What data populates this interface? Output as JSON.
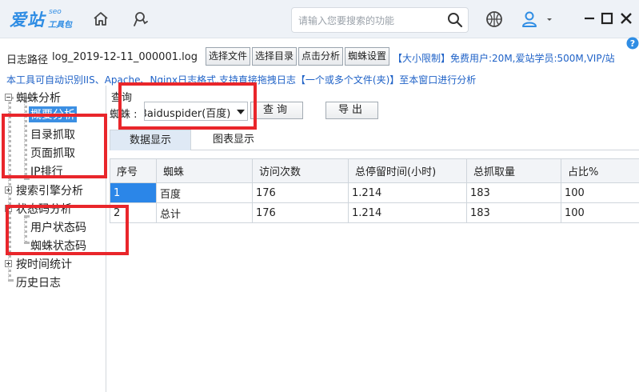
{
  "app": {
    "logo_text": "爱站",
    "logo_seo": "seo",
    "logo_sub": "工具包"
  },
  "titlebar": {
    "search_placeholder": "请输入您要搜索的功能",
    "icons": [
      "home-icon",
      "spider-tool-icon",
      "search-icon",
      "basketball-icon",
      "user-icon",
      "dropdown-icon",
      "close-icon",
      "maximize-icon",
      "minimize-icon"
    ]
  },
  "toolbar": {
    "path_label": "日志路径",
    "path_value": "log_2019-12-11_000001.log",
    "btn_select_file": "选择文件",
    "btn_select_dir": "选择目录",
    "btn_analyze": "点击分析",
    "btn_spider_settings": "蜘蛛设置",
    "size_limit_info": "【大小限制】免费用户:20M,爱站学员:500M,VIP/站",
    "tip": "本工具可自动识别IIS、Apache、Nginx日志格式,支持直接拖拽日志【一个或多个文件(夹)】至本窗口进行分析"
  },
  "sidebar": {
    "items": [
      {
        "label": "蜘蛛分析"
      },
      {
        "label": "概要分析"
      },
      {
        "label": "目录抓取"
      },
      {
        "label": "页面抓取"
      },
      {
        "label": "IP排行"
      },
      {
        "label": "搜索引擎分析"
      },
      {
        "label": "状态码分析"
      },
      {
        "label": "用户状态码"
      },
      {
        "label": "蜘蛛状态码"
      },
      {
        "label": "按时间统计"
      },
      {
        "label": "历史日志"
      }
    ]
  },
  "query": {
    "group_title": "查询",
    "spider_label": "蜘蛛 :",
    "spider_selected": "Baiduspider(百度)",
    "query_button": "查询",
    "export_button": "导出"
  },
  "tabs": [
    {
      "label": "数据显示",
      "active": true
    },
    {
      "label": "图表显示",
      "active": false
    }
  ],
  "table": {
    "columns": [
      "序号",
      "蜘蛛",
      "访问次数",
      "总停留时间(小时)",
      "总抓取量",
      "占比%"
    ],
    "rows": [
      [
        "1",
        "百度",
        "176",
        "1.214",
        "183",
        "100"
      ],
      [
        "2",
        "总计",
        "176",
        "1.214",
        "183",
        "100"
      ]
    ]
  },
  "colors": {
    "accent": "#2b86e8",
    "link_text": "#1f62c7",
    "annotation": "#e9262b"
  }
}
